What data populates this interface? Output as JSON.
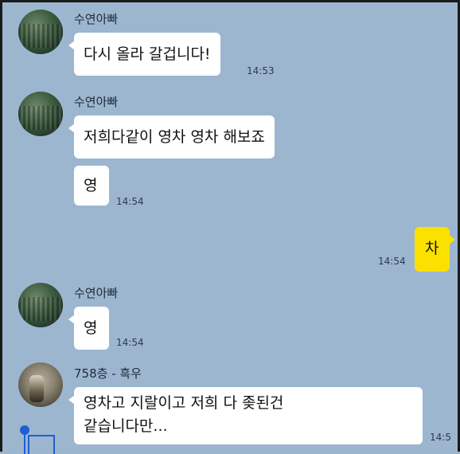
{
  "messages": [
    {
      "sender": "수연아빠",
      "text": "다시 올라 갈겁니다!",
      "time": "14:53"
    },
    {
      "sender": "수연아빠",
      "text": "저희다같이 영차 영차 해보죠"
    },
    {
      "text": "영",
      "time": "14:54"
    },
    {
      "sender": "me",
      "text": "차",
      "time": "14:54"
    },
    {
      "sender": "수연아빠",
      "text": "영",
      "time": "14:54"
    },
    {
      "sender": "758층 - 흑우",
      "text_line1": "영차고 지랄이고 저희 다 좆된건",
      "text_line2": "같습니다만...",
      "time": "14:5"
    }
  ],
  "colors": {
    "background": "#9db6d0",
    "incoming_bubble": "#ffffff",
    "outgoing_bubble": "#fae100",
    "scroll_marker": "#1f5fd1"
  },
  "icons": {
    "avatar": "profile-photo",
    "scroll_marker": "text-cursor-handle"
  }
}
